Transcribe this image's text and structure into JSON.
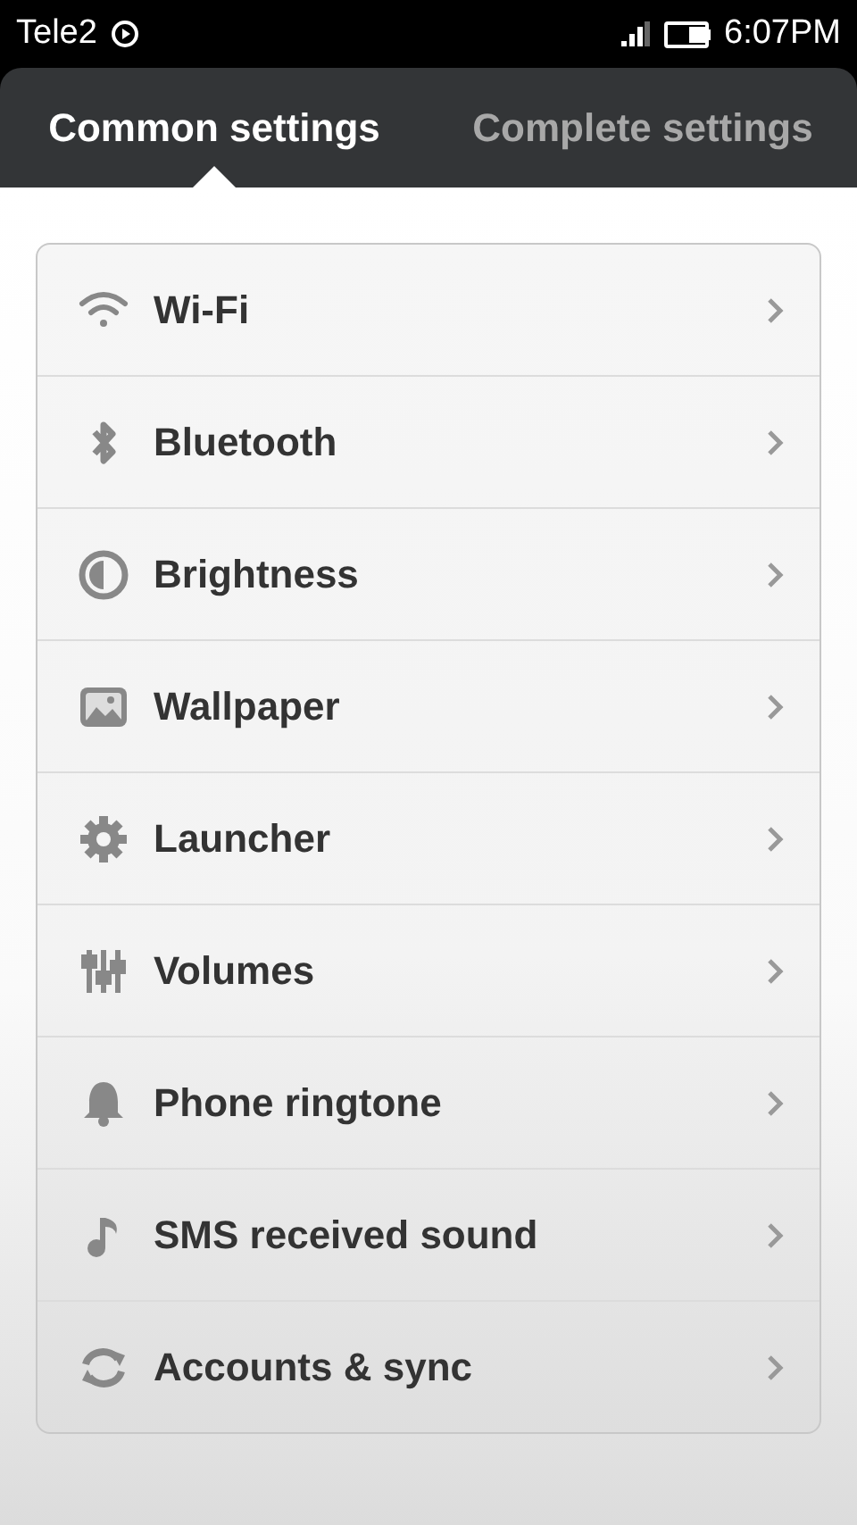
{
  "status_bar": {
    "carrier": "Tele2",
    "time": "6:07PM"
  },
  "tabs": [
    {
      "label": "Common settings",
      "selected": true
    },
    {
      "label": "Complete settings",
      "selected": false
    }
  ],
  "items": [
    {
      "kind": "wifi",
      "label": "Wi-Fi"
    },
    {
      "kind": "bluetooth",
      "label": "Bluetooth"
    },
    {
      "kind": "brightness",
      "label": "Brightness"
    },
    {
      "kind": "wallpaper",
      "label": "Wallpaper"
    },
    {
      "kind": "launcher",
      "label": "Launcher"
    },
    {
      "kind": "volumes",
      "label": "Volumes"
    },
    {
      "kind": "ringtone",
      "label": "Phone ringtone"
    },
    {
      "kind": "sms",
      "label": "SMS received sound"
    },
    {
      "kind": "sync",
      "label": "Accounts & sync"
    }
  ]
}
